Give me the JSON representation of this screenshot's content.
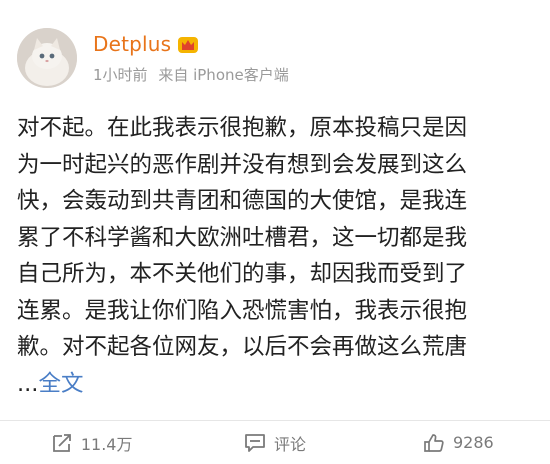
{
  "post": {
    "username": "Detplus",
    "time": "1小时前",
    "source": "来自 iPhone客户端",
    "lines": [
      "对不起。在此我表示很抱歉，原本投稿只是因",
      "为一时起兴的恶作剧并没有想到会发展到这么",
      "快，会轰动到共青团和德国的大使馆，是我连",
      "累了不科学酱和大欧洲吐槽君，这一切都是我",
      "自己所为，本不关他们的事，却因我而受到了",
      "连累。是我让你们陷入恐慌害怕，我表示很抱",
      "歉。对不起各位网友，以后不会再做这么荒唐"
    ],
    "ellipsis": "...",
    "full_text_link": "全文"
  },
  "actions": {
    "repost_count": "11.4万",
    "comment_label": "评论",
    "like_count": "9286"
  },
  "colors": {
    "username": "#e8741a",
    "link": "#4a7ec6",
    "meta": "#9a9a9a"
  },
  "icons": [
    "avatar",
    "crown-icon",
    "repost-icon",
    "comment-icon",
    "like-icon"
  ]
}
